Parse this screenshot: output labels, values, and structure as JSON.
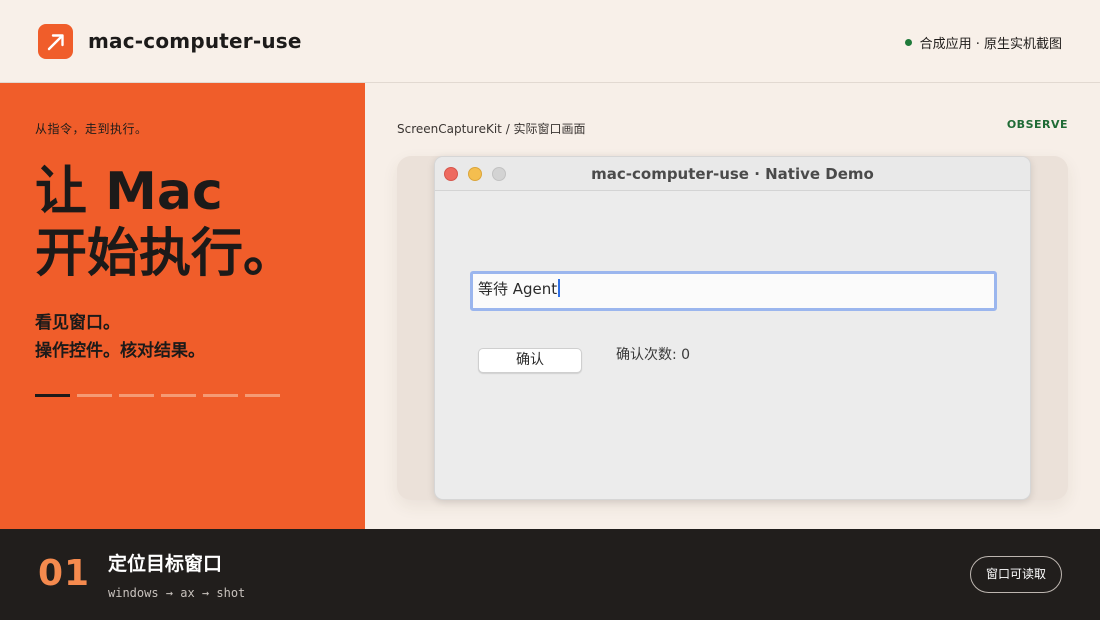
{
  "header": {
    "app_name": "mac-computer-use",
    "logo_icon": "arrow-up-right-icon",
    "status_text": "合成应用 · 原生实机截图",
    "status_color": "#1f7a3a"
  },
  "hero": {
    "eyebrow": "从指令，走到执行。",
    "title_line1": "让 Mac",
    "title_line2": "开始执行。",
    "sub_line1": "看见窗口。",
    "sub_line2": "操作控件。核对结果。",
    "progress": {
      "current_step": 1,
      "total_steps": 6
    },
    "accent_color": "#f05d2a"
  },
  "stage": {
    "breadcrumb": "ScreenCaptureKit / 实际窗口画面",
    "mode_label": "OBSERVE",
    "window": {
      "title": "mac-computer-use · Native Demo",
      "text_field_value": "等待 Agent",
      "confirm_button_label": "确认",
      "count_label": "确认次数: 0"
    }
  },
  "footer": {
    "step_number": "01",
    "step_title": "定位目标窗口",
    "step_flow": "windows → ax → shot",
    "badge_label": "窗口可读取"
  }
}
